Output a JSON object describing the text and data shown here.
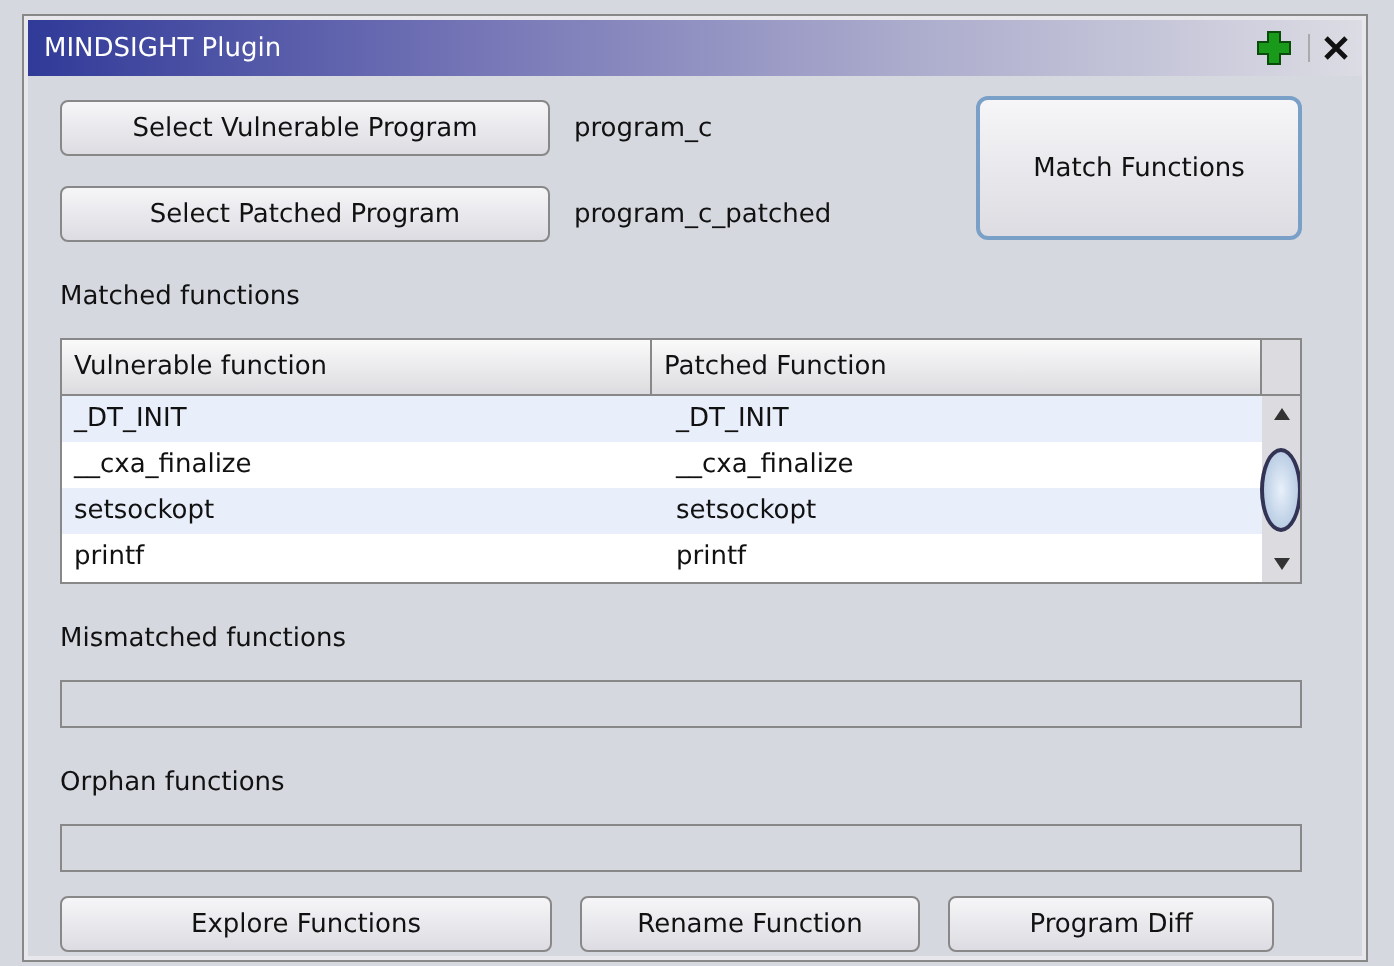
{
  "window": {
    "title": "MINDSIGHT Plugin"
  },
  "programs": [
    {
      "button": "Select Vulnerable Program",
      "value": "program_c"
    },
    {
      "button": "Select Patched Program",
      "value": "program_c_patched"
    }
  ],
  "match_button": "Match Functions",
  "matched": {
    "label": "Matched functions",
    "columns": [
      "Vulnerable function",
      "Patched Function"
    ],
    "rows": [
      [
        "_DT_INIT",
        "_DT_INIT"
      ],
      [
        "__cxa_finalize",
        "__cxa_finalize"
      ],
      [
        "setsockopt",
        "setsockopt"
      ],
      [
        "printf",
        "printf"
      ]
    ]
  },
  "mismatched": {
    "label": "Mismatched functions"
  },
  "orphans": {
    "label": "Orphan functions"
  },
  "buttons": [
    "Explore Functions",
    "Rename Function",
    "Program Diff"
  ]
}
